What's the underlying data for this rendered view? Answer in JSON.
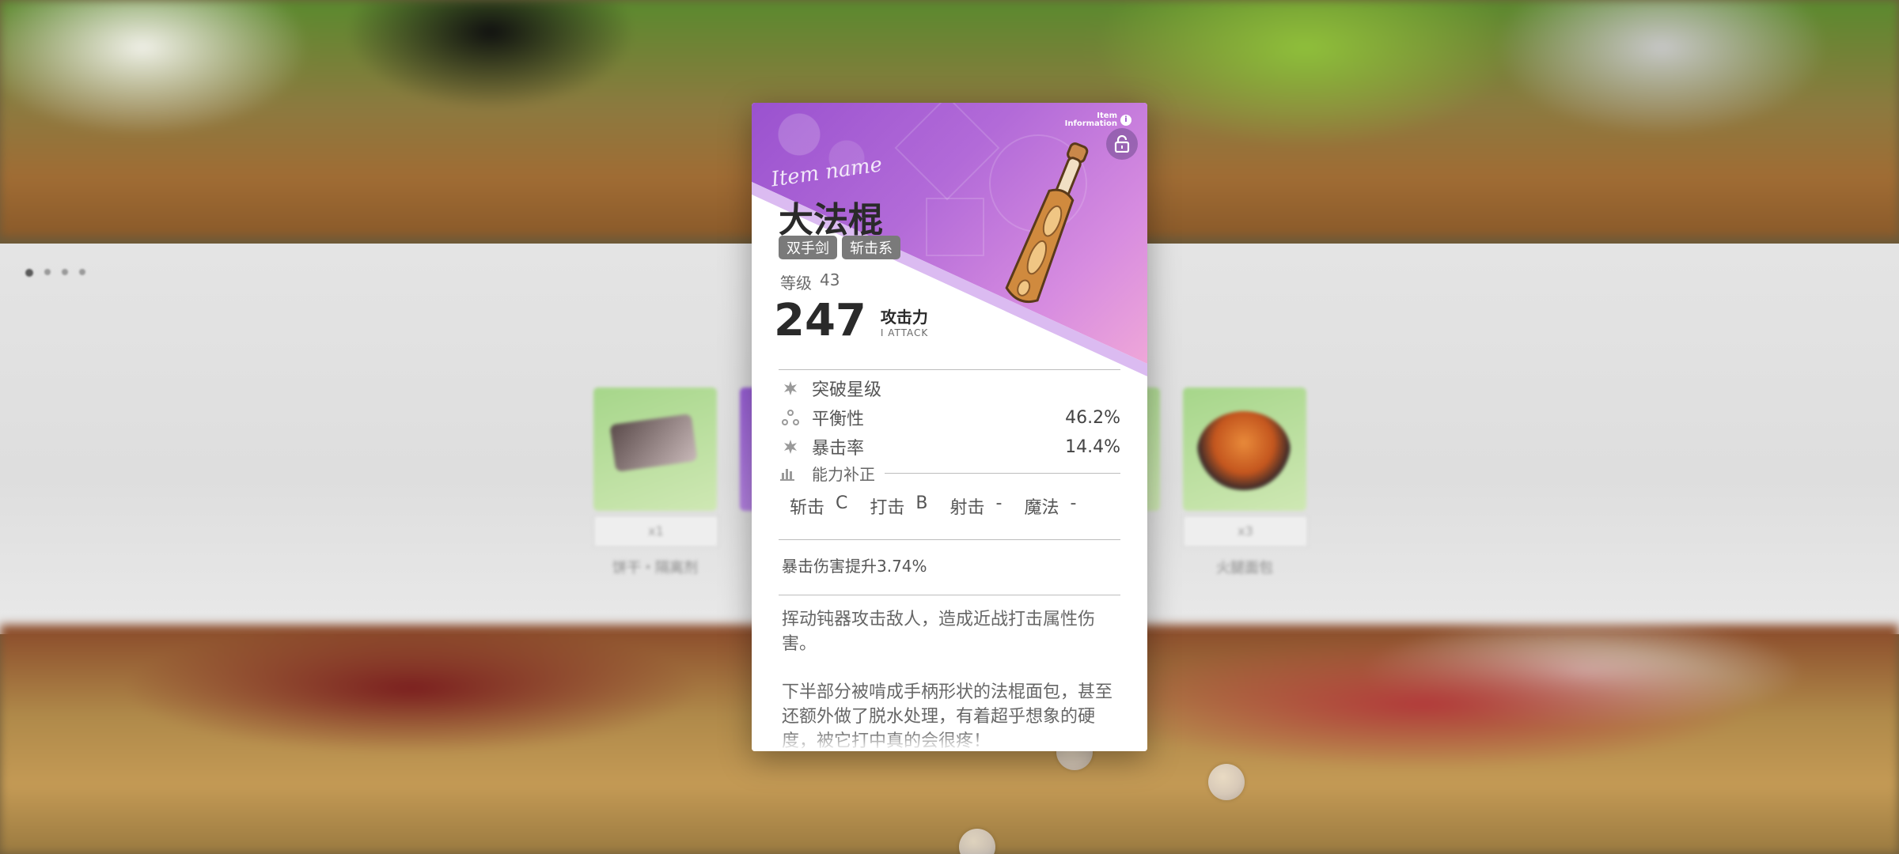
{
  "item": {
    "script_label": "Item name",
    "name": "大法棍",
    "tags": [
      "双手剑",
      "斩击系"
    ],
    "level_label": "等级",
    "level_value": "43",
    "attack_value": "247",
    "attack_label": "攻击力",
    "attack_sub": "I ATTACK",
    "info_label_line1": "Item",
    "info_label_line2": "Information"
  },
  "stats": [
    {
      "icon": "star-burst-icon",
      "name": "突破星级",
      "value": ""
    },
    {
      "icon": "balance-icon",
      "name": "平衡性",
      "value": "46.2%"
    },
    {
      "icon": "critical-icon",
      "name": "暴击率",
      "value": "14.4%"
    }
  ],
  "adjust": {
    "title": "能力补正",
    "items": [
      {
        "name": "斩击",
        "grade": "C"
      },
      {
        "name": "打击",
        "grade": "B"
      },
      {
        "name": "射击",
        "grade": "-"
      },
      {
        "name": "魔法",
        "grade": "-"
      }
    ]
  },
  "bonus_text": "暴击伤害提升3.74%",
  "description": [
    "挥动钝器攻击敌人，造成近战打击属性伤害。",
    "下半部分被啃成手柄形状的法棍面包，甚至还额外做了脱水处理，有着超乎想象的硬度，被它打中真的会很疼！"
  ],
  "background": {
    "cards": [
      {
        "count": "x1",
        "label": "饼干・隔离剂"
      },
      {
        "count": "x3",
        "label": "火腿面包"
      }
    ]
  },
  "colors": {
    "hero_purple": "#9a52cf",
    "hero_pink": "#f0a8d8",
    "text_dark": "#2a2a2a",
    "tag_gray": "#7a7a7a"
  }
}
